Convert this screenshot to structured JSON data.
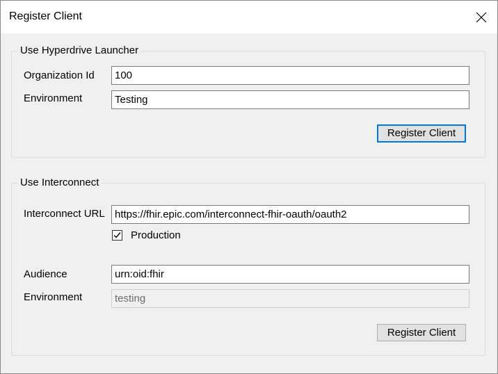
{
  "window": {
    "title": "Register Client",
    "close_icon": "close-icon"
  },
  "hyperdrive": {
    "legend": "Use Hyperdrive Launcher",
    "org_label": "Organization Id",
    "org_value": "100",
    "env_label": "Environment",
    "env_value": "Testing",
    "register_label": "Register Client"
  },
  "interconnect": {
    "legend": "Use Interconnect",
    "url_label": "Interconnect URL",
    "url_value": "https://fhir.epic.com/interconnect-fhir-oauth/oauth2",
    "production_label": "Production",
    "production_checked": true,
    "audience_label": "Audience",
    "audience_value": "urn:oid:fhir",
    "env_label": "Environment",
    "env_value": "testing",
    "register_label": "Register Client"
  },
  "colors": {
    "accent": "#0078d7",
    "window_bg": "#f0f0f0",
    "button_bg": "#e1e1e1"
  }
}
